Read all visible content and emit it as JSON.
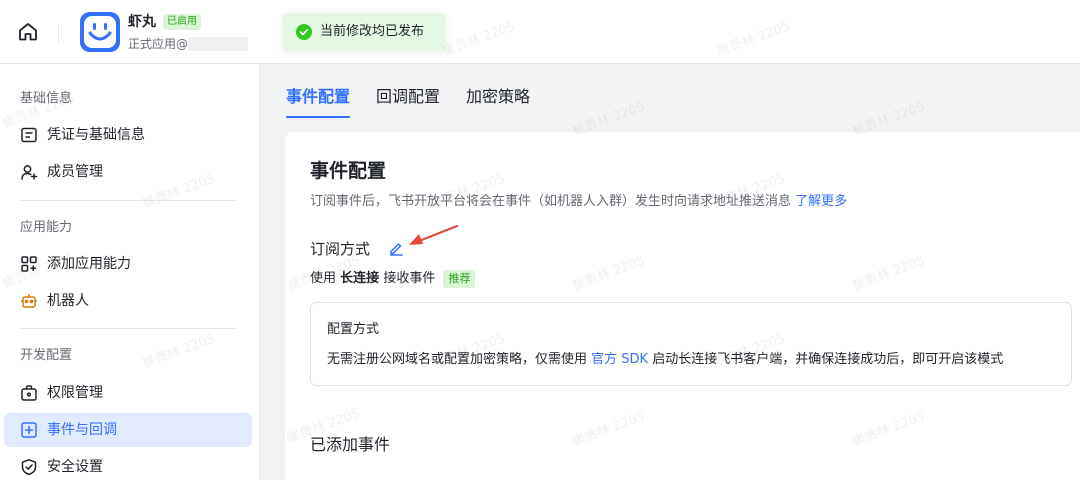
{
  "header": {
    "app_name": "虾丸",
    "status_badge": "已启用",
    "app_type": "正式应用@",
    "toast": "当前修改均已发布"
  },
  "sidebar": {
    "groups": [
      "基础信息",
      "应用能力",
      "开发配置"
    ],
    "items": [
      {
        "label": "凭证与基础信息",
        "icon": "credential-icon"
      },
      {
        "label": "成员管理",
        "icon": "member-icon"
      },
      {
        "label": "添加应用能力",
        "icon": "app-capability-icon"
      },
      {
        "label": "机器人",
        "icon": "robot-icon"
      },
      {
        "label": "权限管理",
        "icon": "permission-icon"
      },
      {
        "label": "事件与回调",
        "icon": "event-icon",
        "active": true
      },
      {
        "label": "安全设置",
        "icon": "shield-icon"
      }
    ]
  },
  "tabs": [
    {
      "label": "事件配置",
      "active": true
    },
    {
      "label": "回调配置"
    },
    {
      "label": "加密策略"
    }
  ],
  "content": {
    "title": "事件配置",
    "desc": "订阅事件后，飞书开放平台将会在事件（如机器人入群）发生时向请求地址推送消息",
    "learn_more": "了解更多",
    "subscribe_title": "订阅方式",
    "method_prefix": "使用",
    "method_name": "长连接",
    "method_suffix": "接收事件",
    "recommend_badge": "推荐",
    "config_title": "配置方式",
    "config_desc_1": "无需注册公网域名或配置加密策略，仅需使用",
    "config_sdk_link": "官方 SDK",
    "config_desc_2": "启动长连接飞书客户端，并确保连接成功后，即可开启该模式",
    "added_events_title": "已添加事件"
  },
  "watermark": "崔贵林 2205",
  "colors": {
    "accent": "#3370ff",
    "active_bg": "#e1eaff",
    "success": "#2ea121",
    "success_bg": "#d9f5d6",
    "annotation_arrow": "#e8483b"
  }
}
